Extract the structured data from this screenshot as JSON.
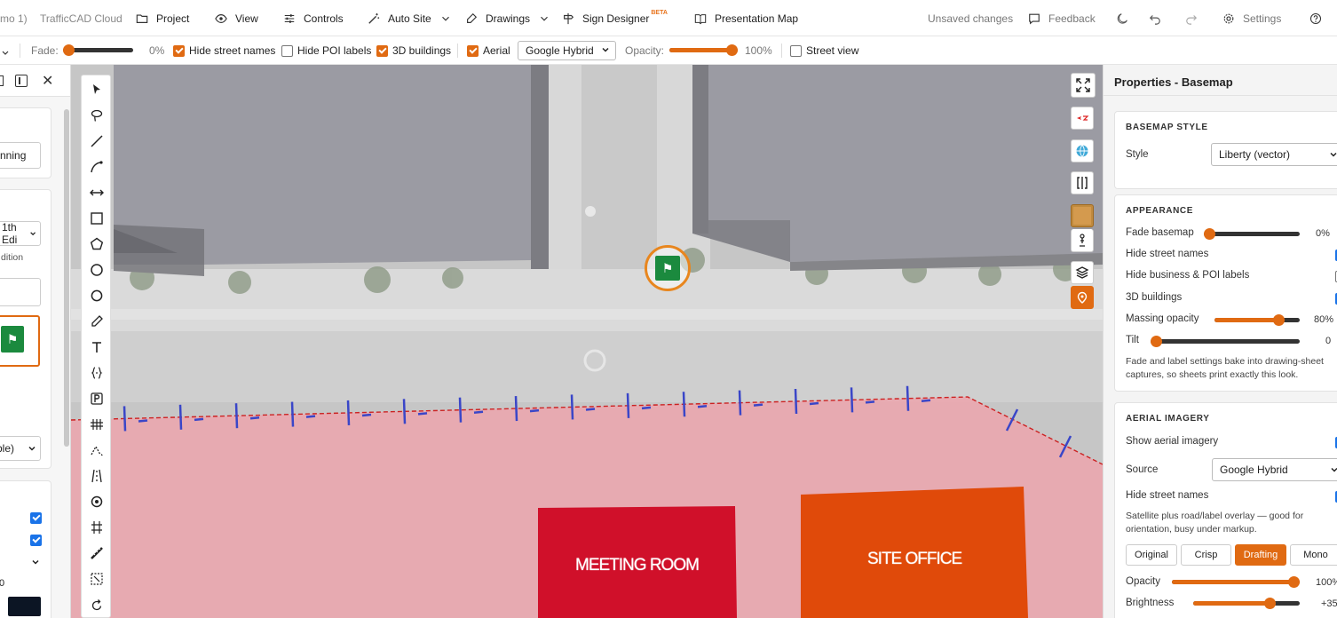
{
  "menubar": {
    "doc_fragment": "mo 1)",
    "app_name": "TrafficCAD Cloud",
    "items": [
      {
        "label": "Project",
        "icon": "folder-icon"
      },
      {
        "label": "View",
        "icon": "eye-icon"
      },
      {
        "label": "Controls",
        "icon": "sliders-icon"
      },
      {
        "label": "Auto Site",
        "icon": "magic-wand-icon"
      },
      {
        "label": "Drawings",
        "icon": "drawings-icon"
      },
      {
        "label": "Sign Designer",
        "icon": "sign-icon",
        "badge": "BETA"
      },
      {
        "label": "Presentation Map",
        "icon": "book-map-icon"
      }
    ],
    "status": "Unsaved changes",
    "feedback": "Feedback",
    "settings": "Settings"
  },
  "toolbar": {
    "fade_label": "Fade:",
    "fade_value": "0%",
    "fade_level": 0,
    "hide_street_names": {
      "label": "Hide street names",
      "checked": true
    },
    "hide_poi_labels": {
      "label": "Hide POI labels",
      "checked": false
    },
    "buildings_3d": {
      "label": "3D buildings",
      "checked": true
    },
    "aerial": {
      "label": "Aerial",
      "checked": true
    },
    "source_select": "Google Hybrid",
    "opacity_label": "Opacity:",
    "opacity_value": "100%",
    "opacity_level": 100,
    "street_view": {
      "label": "Street view",
      "checked": false
    }
  },
  "left_panel": {
    "button_fragment": "nning",
    "select_fragment": "1th Edi",
    "sub_fragment": "dition",
    "select2_fragment": "ble)",
    "number_fragment": "0"
  },
  "map": {
    "labels": {
      "meeting_room": "MEETING ROOM",
      "site_office": "SITE OFFICE"
    }
  },
  "properties": {
    "title": "Properties - Basemap",
    "basemap_style": {
      "heading": "BASEMAP STYLE",
      "style_label": "Style",
      "style_value": "Liberty (vector)"
    },
    "appearance": {
      "heading": "APPEARANCE",
      "fade_label": "Fade basemap",
      "fade_value": "0%",
      "fade_level": 0,
      "hide_street_names": {
        "label": "Hide street names",
        "checked": true
      },
      "hide_poi": {
        "label": "Hide business & POI labels",
        "checked": false
      },
      "buildings_3d": {
        "label": "3D buildings",
        "checked": true
      },
      "massing_label": "Massing opacity",
      "massing_value": "80%",
      "massing_level": 80,
      "tilt_label": "Tilt",
      "tilt_value": "0",
      "tilt_level": 0,
      "note": "Fade and label settings bake into drawing-sheet captures, so sheets print exactly this look."
    },
    "aerial": {
      "heading": "AERIAL IMAGERY",
      "show_label": "Show aerial imagery",
      "show_checked": true,
      "source_label": "Source",
      "source_value": "Google Hybrid",
      "hide_street_names": {
        "label": "Hide street names",
        "checked": true
      },
      "note": "Satellite plus road/label overlay — good for orientation, busy under markup.",
      "modes": [
        "Original",
        "Crisp",
        "Drafting",
        "Mono"
      ],
      "active_mode": "Drafting",
      "opacity_label": "Opacity",
      "opacity_value": "100%",
      "opacity_level": 100,
      "brightness_label": "Brightness",
      "brightness_value": "+35"
    }
  },
  "colors": {
    "accent": "#e06a12",
    "checkbox_blue": "#1a73e8",
    "zone_pink": "#e9a9b0",
    "meeting_room": "#d0102a",
    "site_office": "#e04a0a"
  }
}
